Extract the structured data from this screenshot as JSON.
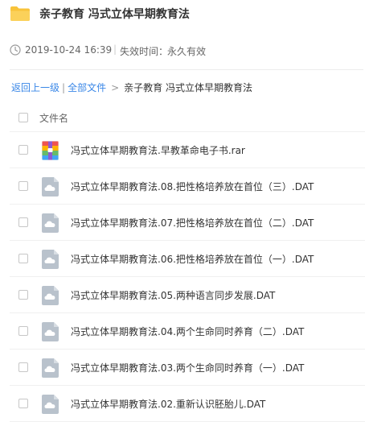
{
  "header": {
    "title": "亲子教育 冯式立体早期教育法",
    "folder_icon": "folder-icon"
  },
  "meta": {
    "date": "2019-10-24 16:39",
    "separator": "|",
    "expire_label": "失效时间：",
    "expire_value": "永久有效"
  },
  "breadcrumb": {
    "back": "返回上一级",
    "bar": "|",
    "all_files": "全部文件",
    "arrow": ">",
    "current": "亲子教育 冯式立体早期教育法"
  },
  "list_header": {
    "name": "文件名"
  },
  "files": [
    {
      "name": "冯式立体早期教育法.早教革命电子书.rar",
      "icon": "rar-archive-icon"
    },
    {
      "name": "冯式立体早期教育法.08.把性格培养放在首位（三）.DAT",
      "icon": "cloud-file-icon"
    },
    {
      "name": "冯式立体早期教育法.07.把性格培养放在首位（二）.DAT",
      "icon": "cloud-file-icon"
    },
    {
      "name": "冯式立体早期教育法.06.把性格培养放在首位（一）.DAT",
      "icon": "cloud-file-icon"
    },
    {
      "name": "冯式立体早期教育法.05.两种语言同步发展.DAT",
      "icon": "cloud-file-icon"
    },
    {
      "name": "冯式立体早期教育法.04.两个生命同时养育（二）.DAT",
      "icon": "cloud-file-icon"
    },
    {
      "name": "冯式立体早期教育法.03.两个生命同时养育（一）.DAT",
      "icon": "cloud-file-icon"
    },
    {
      "name": "冯式立体早期教育法.02.重新认识胚胎儿.DAT",
      "icon": "cloud-file-icon"
    }
  ],
  "colors": {
    "link": "#3a87e7",
    "folder": "#f8c33a",
    "file_icon": "#b9c2cc"
  }
}
